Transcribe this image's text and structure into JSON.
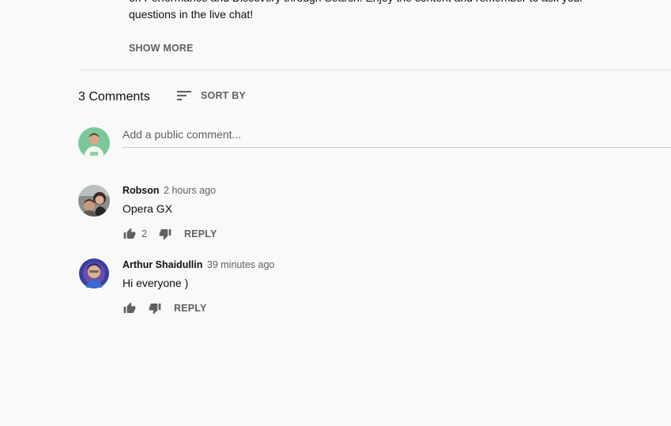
{
  "description": {
    "line1": "on Performance and Discovery through Search. Enjoy the content and remember to ask your",
    "line2": "questions in the live chat!",
    "show_more": "SHOW MORE"
  },
  "comments_section": {
    "count_label": "3 Comments",
    "sort_label": "SORT BY",
    "add_comment_placeholder": "Add a public comment..."
  },
  "comments": [
    {
      "author": "Robson",
      "time": "2 hours ago",
      "text": "Opera GX",
      "likes": "2",
      "reply_label": "REPLY"
    },
    {
      "author": "Arthur Shaidullin",
      "time": "39 minutes ago",
      "text": "Hi everyone )",
      "likes": "",
      "reply_label": "REPLY"
    }
  ],
  "icons": {
    "sort": "sort-icon",
    "like": "thumb-up-icon",
    "dislike": "thumb-down-icon"
  },
  "colors": {
    "background": "#f9f9f9",
    "text_primary": "#0f0f0f",
    "text_secondary": "#606060",
    "divider": "#e0e0e0"
  }
}
